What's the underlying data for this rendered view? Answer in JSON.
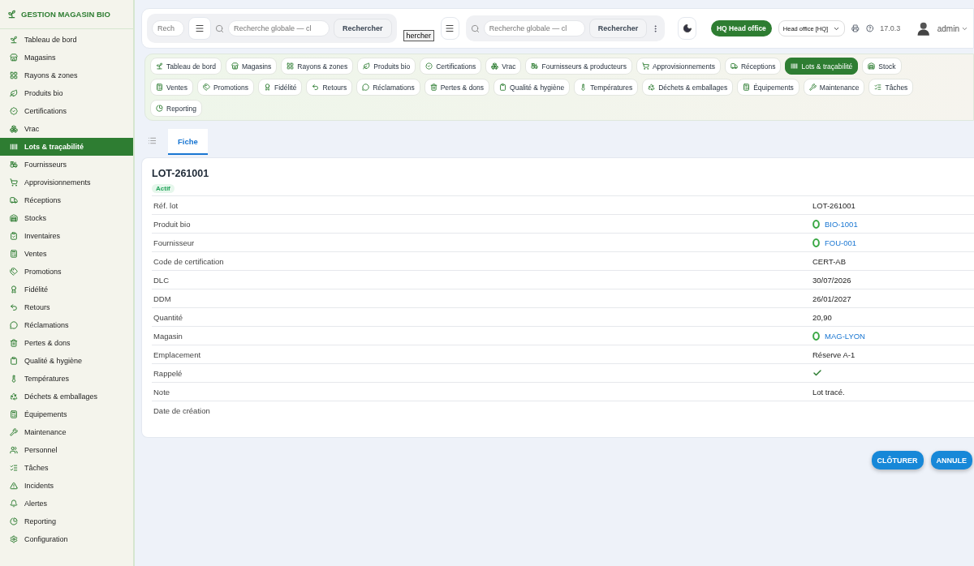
{
  "sidebar": {
    "brand": "GESTION MAGASIN BIO",
    "items": [
      {
        "label": "Tableau de bord",
        "selected": false
      },
      {
        "label": "Magasins",
        "selected": false
      },
      {
        "label": "Rayons & zones",
        "selected": false
      },
      {
        "label": "Produits bio",
        "selected": false
      },
      {
        "label": "Certifications",
        "selected": false
      },
      {
        "label": "Vrac",
        "selected": false
      },
      {
        "label": "Lots & traçabilité",
        "selected": true
      },
      {
        "label": "Fournisseurs",
        "selected": false
      },
      {
        "label": "Approvisionnements",
        "selected": false
      },
      {
        "label": "Réceptions",
        "selected": false
      },
      {
        "label": "Stocks",
        "selected": false
      },
      {
        "label": "Inventaires",
        "selected": false
      },
      {
        "label": "Ventes",
        "selected": false
      },
      {
        "label": "Promotions",
        "selected": false
      },
      {
        "label": "Fidélité",
        "selected": false
      },
      {
        "label": "Retours",
        "selected": false
      },
      {
        "label": "Réclamations",
        "selected": false
      },
      {
        "label": "Pertes & dons",
        "selected": false
      },
      {
        "label": "Qualité & hygiène",
        "selected": false
      },
      {
        "label": "Températures",
        "selected": false
      },
      {
        "label": "Déchets & emballages",
        "selected": false
      },
      {
        "label": "Équipements",
        "selected": false
      },
      {
        "label": "Maintenance",
        "selected": false
      },
      {
        "label": "Personnel",
        "selected": false
      },
      {
        "label": "Tâches",
        "selected": false
      },
      {
        "label": "Incidents",
        "selected": false
      },
      {
        "label": "Alertes",
        "selected": false
      },
      {
        "label": "Reporting",
        "selected": false
      },
      {
        "label": "Configuration",
        "selected": false
      }
    ]
  },
  "header": {
    "search_1": {
      "stub_placeholder": "Rech",
      "placeholder": "Recherche globale — cl",
      "button": "Rechercher"
    },
    "stray_button": "hercher",
    "search_2": {
      "placeholder": "Recherche globale — cl",
      "button": "Rechercher"
    },
    "office_badge": "HQ Head office",
    "office_select": "Head office [HQ]",
    "version": "17.0.3",
    "user": "admin"
  },
  "module_tabs": [
    [
      {
        "label": "Tableau de bord",
        "selected": false
      },
      {
        "label": "Magasins",
        "selected": false
      },
      {
        "label": "Rayons & zones",
        "selected": false
      },
      {
        "label": "Produits bio",
        "selected": false
      },
      {
        "label": "Certifications",
        "selected": false
      },
      {
        "label": "Vrac",
        "selected": false
      },
      {
        "label": "Fournisseurs & producteurs",
        "selected": false
      },
      {
        "label": "Approvisionnements",
        "selected": false
      },
      {
        "label": "Réceptions",
        "selected": false
      },
      {
        "label": "Lots & traçabilité",
        "selected": true
      },
      {
        "label": "Stock",
        "selected": false
      }
    ],
    [
      {
        "label": "Ventes",
        "selected": false
      },
      {
        "label": "Promotions",
        "selected": false
      },
      {
        "label": "Fidélité",
        "selected": false
      },
      {
        "label": "Retours",
        "selected": false
      },
      {
        "label": "Réclamations",
        "selected": false
      },
      {
        "label": "Pertes & dons",
        "selected": false
      },
      {
        "label": "Qualité & hygiène",
        "selected": false
      },
      {
        "label": "Températures",
        "selected": false
      },
      {
        "label": "Déchets & emballages",
        "selected": false
      },
      {
        "label": "Équipements",
        "selected": false
      },
      {
        "label": "Maintenance",
        "selected": false
      },
      {
        "label": "Tâches",
        "selected": false
      }
    ],
    [
      {
        "label": "Reporting",
        "selected": false
      }
    ]
  ],
  "view_tabs": [
    {
      "kind": "icon",
      "selected": false
    },
    {
      "kind": "text",
      "label": "Fiche",
      "selected": true
    }
  ],
  "record": {
    "title": "LOT-261001",
    "status": "Actif",
    "fields": [
      {
        "label": "Réf. lot",
        "kind": "text",
        "value": "LOT-261001"
      },
      {
        "label": "Produit bio",
        "kind": "link",
        "value": "BIO-1001"
      },
      {
        "label": "Fournisseur",
        "kind": "link",
        "value": "FOU-001"
      },
      {
        "label": "Code de certification",
        "kind": "text",
        "value": "CERT-AB"
      },
      {
        "label": "DLC",
        "kind": "text",
        "value": "30/07/2026"
      },
      {
        "label": "DDM",
        "kind": "text",
        "value": "26/01/2027"
      },
      {
        "label": "Quantité",
        "kind": "text",
        "value": "20,90"
      },
      {
        "label": "Magasin",
        "kind": "link",
        "value": "MAG-LYON"
      },
      {
        "label": "Emplacement",
        "kind": "text",
        "value": "Réserve A-1"
      },
      {
        "label": "Rappelé",
        "kind": "boolean",
        "checked": true
      },
      {
        "label": "Note",
        "kind": "text",
        "value": "Lot tracé."
      },
      {
        "label": "Date de création",
        "kind": "empty"
      }
    ]
  },
  "actions": [
    "CLÔTURER",
    "ANNULE"
  ]
}
